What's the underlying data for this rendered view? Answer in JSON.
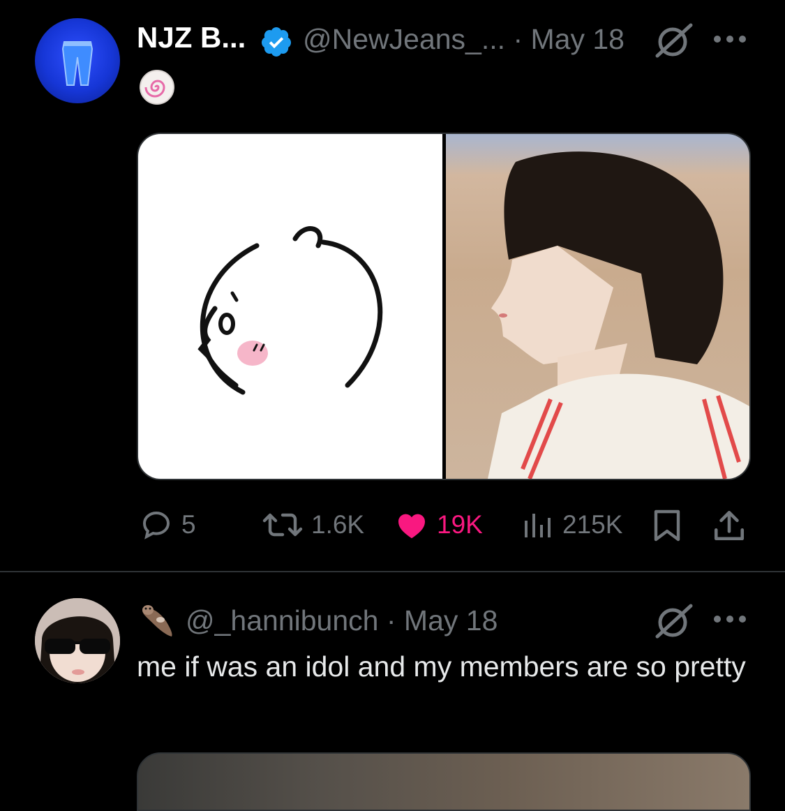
{
  "tweet1": {
    "author_name": "NJZ B...",
    "handle": "@NewJeans_...",
    "separator": "·",
    "date": "May 18",
    "grok_icon": "grok-slash-icon",
    "more_icon": "more-dots-icon",
    "emoji": "naruto-swirl",
    "actions": {
      "replies": "5",
      "retweets": "1.6K",
      "likes": "19K",
      "views": "215K"
    },
    "colors": {
      "like": "#f91880",
      "verified": "#1d9bf0",
      "muted": "#71767b"
    }
  },
  "tweet2": {
    "handle": "@_hannibunch",
    "separator": "·",
    "date": "May 18",
    "text": "me if was an idol and my members are so pretty",
    "badge_emoji": "otter"
  }
}
